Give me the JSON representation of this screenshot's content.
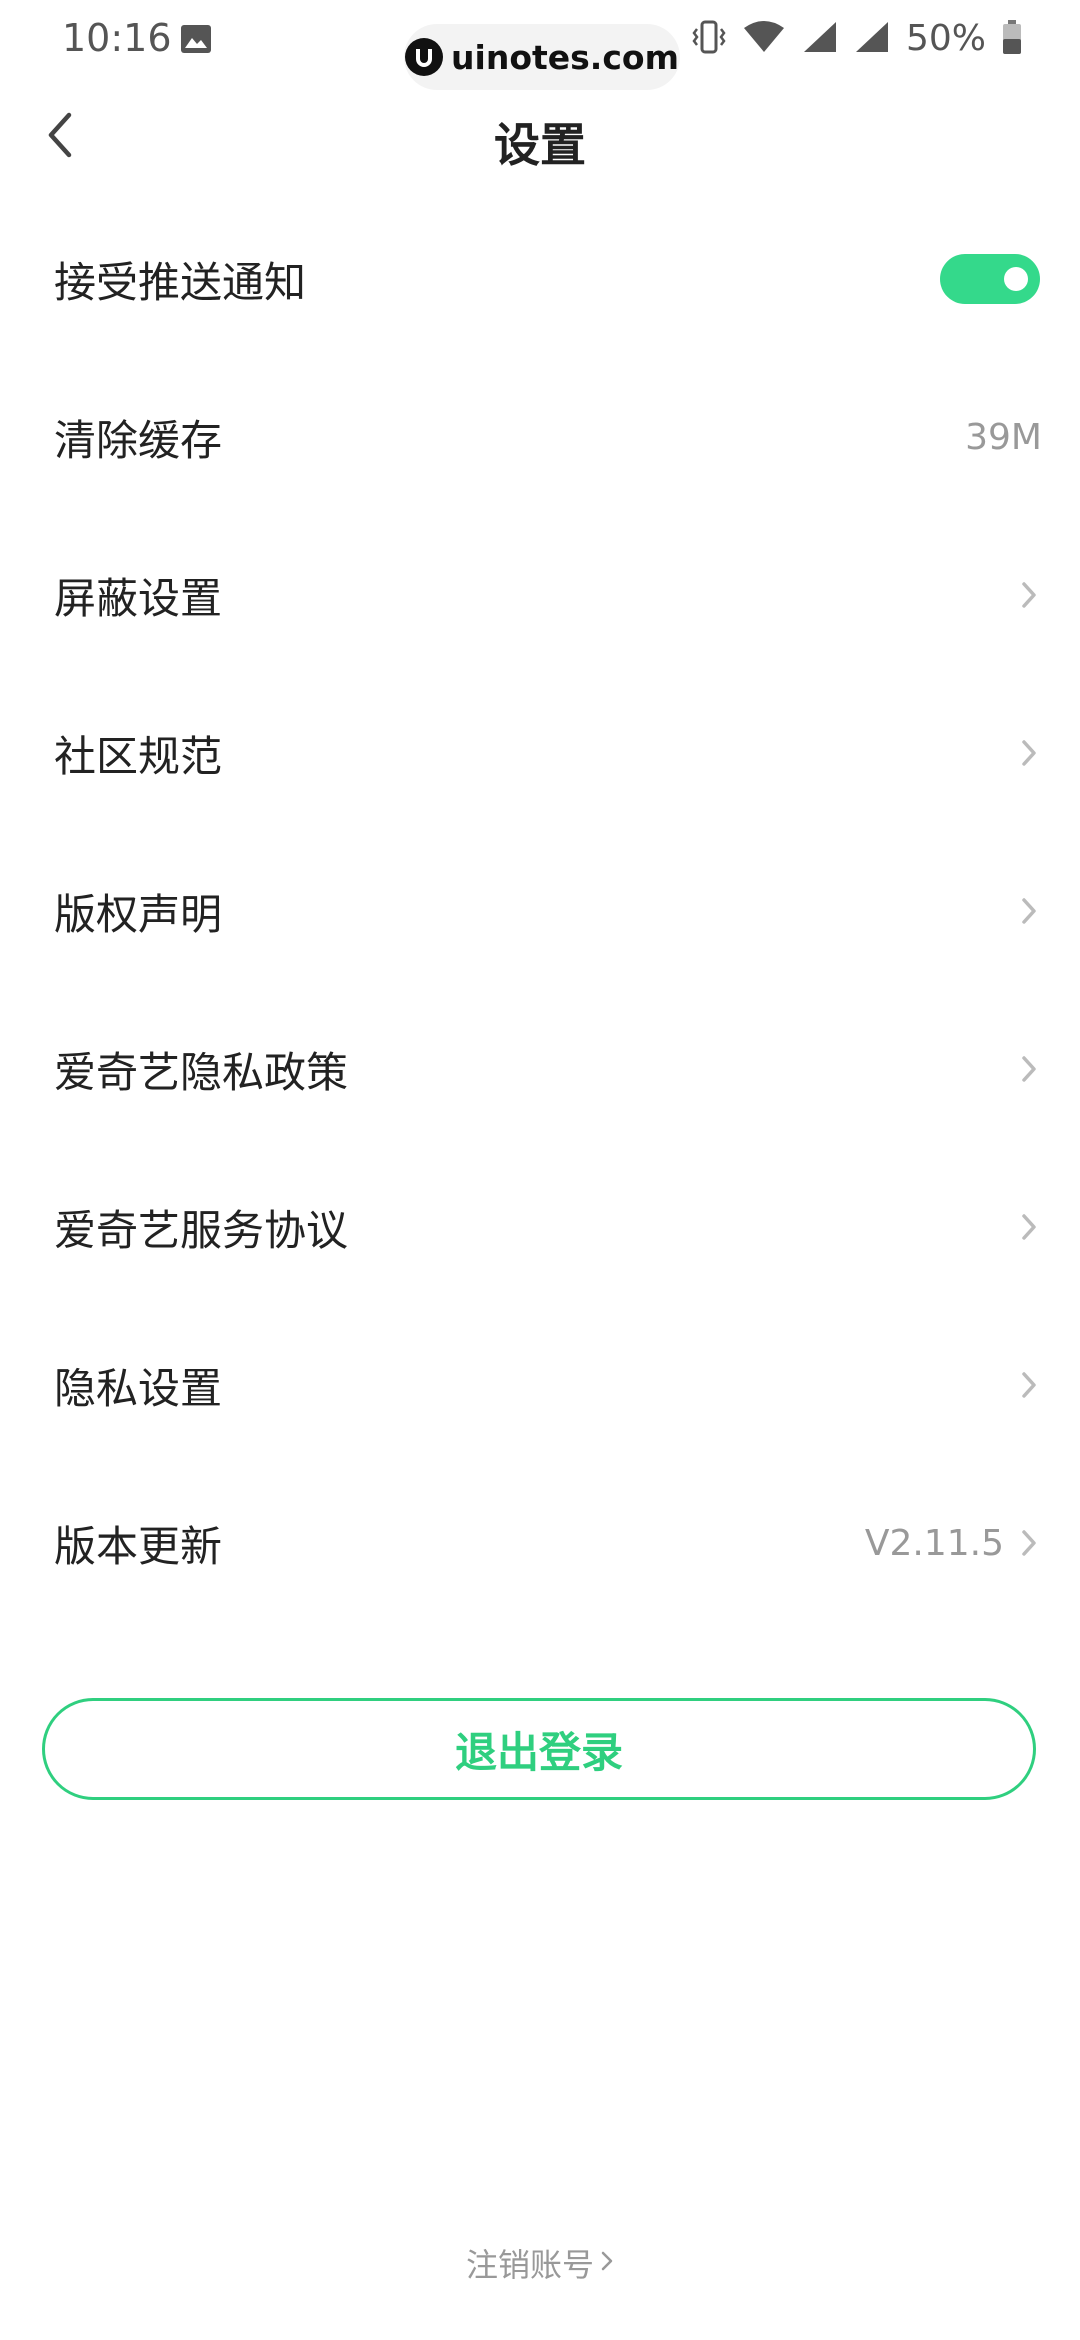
{
  "status_bar": {
    "time": "10:16",
    "battery": "50%",
    "icons": [
      "photo-icon",
      "vibrate-icon",
      "wifi-icon",
      "signal-icon",
      "signal-icon",
      "battery-icon"
    ]
  },
  "watermark": {
    "text": "uinotes.com"
  },
  "header": {
    "title": "设置"
  },
  "settings": {
    "push_notifications": {
      "label": "接受推送通知",
      "enabled": true
    },
    "clear_cache": {
      "label": "清除缓存",
      "value": "39M"
    },
    "block_settings": {
      "label": "屏蔽设置"
    },
    "community_rules": {
      "label": "社区规范"
    },
    "copyright": {
      "label": "版权声明"
    },
    "privacy_policy": {
      "label": "爱奇艺隐私政策"
    },
    "service_agreement": {
      "label": "爱奇艺服务协议"
    },
    "privacy_settings": {
      "label": "隐私设置"
    },
    "version_update": {
      "label": "版本更新",
      "value": "V2.11.5"
    }
  },
  "logout": {
    "label": "退出登录"
  },
  "cancel_account": {
    "label": "注销账号"
  },
  "colors": {
    "accent": "#2fcf7f",
    "toggle_on": "#34d98b",
    "secondary_text": "#999999",
    "primary_text": "#222222"
  }
}
